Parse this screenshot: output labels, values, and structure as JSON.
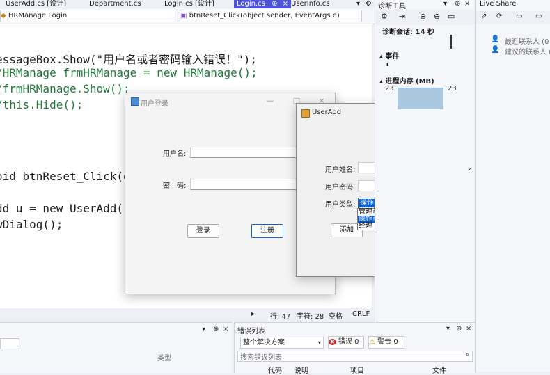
{
  "tabs": [
    {
      "label": "UserAdd.cs [设计]"
    },
    {
      "label": "Department.cs"
    },
    {
      "label": "Login.cs [设计]"
    },
    {
      "label": "Login.cs",
      "pin": "⊕",
      "close": "×"
    },
    {
      "label": "UserInfo.cs"
    }
  ],
  "tabbar_icons": {
    "overflow": "▾",
    "settings": "⚙"
  },
  "navbar": {
    "class_combo": "HRManage.Login",
    "member_combo": "btnReset_Click(object sender, EventArgs e)"
  },
  "code_lines": [
    "essageBox.Show(\"用户名或者密码输入错误！\");",
    "/HRManage frmHRManage = new HRManage();",
    "/frmHRManage.Show();",
    "/this.Hide();",
    "oid btnReset_Click(o",
    "dd u = new UserAdd()",
    "wDialog();"
  ],
  "statusbar": {
    "line": "行: 47",
    "char": "字符: 28",
    "space": "空格",
    "eol": "CRLF"
  },
  "login_window": {
    "title": "用户登录",
    "username_label": "用户名:",
    "password_label": "密　码:",
    "login_button": "登录",
    "register_button": "注册",
    "min": "—",
    "max": "□",
    "close": "×"
  },
  "useradd_window": {
    "title": "UserAdd",
    "name_label": "用户姓名:",
    "password_label": "用户密码:",
    "type_label": "用户类型:",
    "type_selected": "操作员",
    "type_options": [
      "管理员",
      "操作员",
      "经理"
    ],
    "add_button": "添加",
    "reset_button": "重置",
    "min": "—",
    "max": "□",
    "close": "✕"
  },
  "diag": {
    "title": "诊断工具",
    "session": "诊断会话: 14 秒",
    "events": "事件",
    "memory": "进程内存 (MB)",
    "mem_left": "23",
    "mem_right": "23"
  },
  "liveshare": {
    "title": "Live Share",
    "recent": "最近联系人 (0",
    "suggested": "建议的联系人 ("
  },
  "bottom_left": {
    "type_header": "类型"
  },
  "error_list": {
    "title": "错误列表",
    "scope": "整个解决方案",
    "errors": "错误 0",
    "warnings": "警告 0",
    "search_placeholder": "搜索错误列表",
    "cols": [
      "代码",
      "说明",
      "项目",
      "文件"
    ]
  }
}
